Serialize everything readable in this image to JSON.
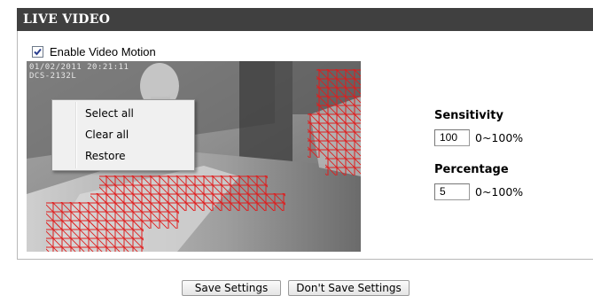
{
  "section": {
    "title": "LIVE VIDEO"
  },
  "motion": {
    "enable_label": "Enable Video Motion",
    "enabled": true
  },
  "video": {
    "osd_line1": "01/02/2011 20:21:11",
    "osd_line2": "DCS-2132L"
  },
  "context_menu": {
    "items": [
      "Select all",
      "Clear all",
      "Restore"
    ]
  },
  "sensitivity": {
    "label": "Sensitivity",
    "value": "100",
    "range": "0~100%"
  },
  "percentage": {
    "label": "Percentage",
    "value": "5",
    "range": "0~100%"
  },
  "buttons": {
    "save": "Save Settings",
    "dont_save": "Don't Save Settings"
  },
  "colors": {
    "header_bg": "#404040",
    "grid_red": "#e01b1b"
  }
}
